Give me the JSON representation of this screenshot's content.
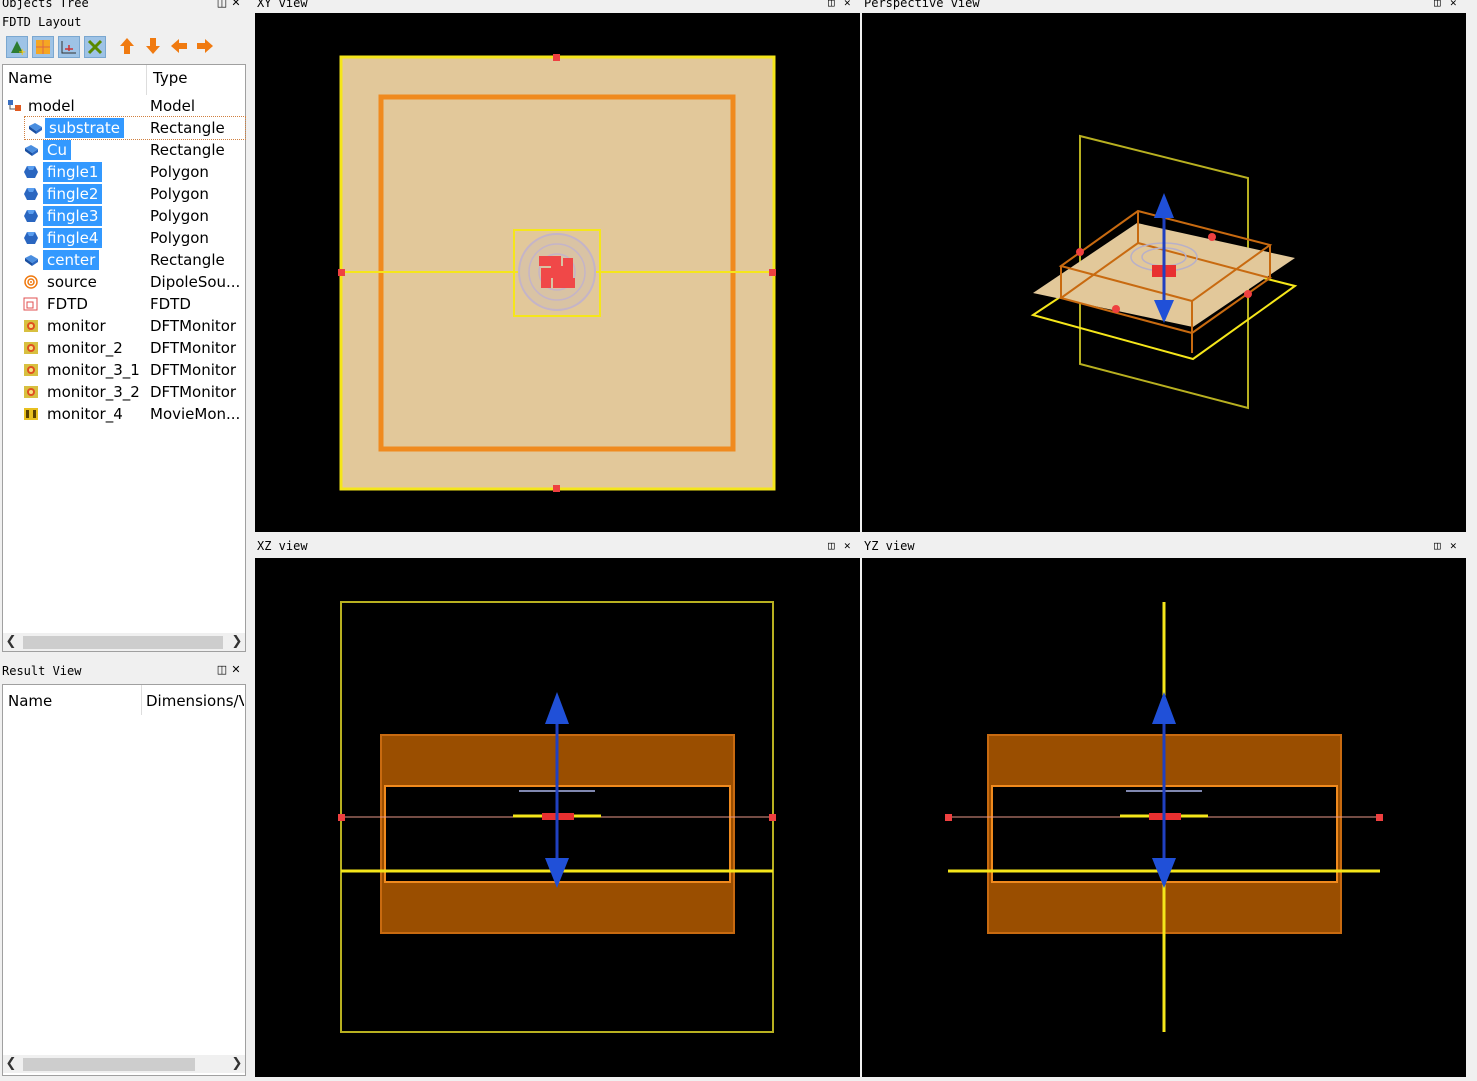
{
  "objects_tree": {
    "title": "Objects Tree",
    "subtitle": "FDTD Layout",
    "header": {
      "name": "Name",
      "type": "Type"
    },
    "rows": [
      {
        "name": "model",
        "type": "Model",
        "icon": "model-icon",
        "selected": false
      },
      {
        "name": "substrate",
        "type": "Rectangle",
        "icon": "rectangle-icon",
        "selected": true
      },
      {
        "name": "Cu",
        "type": "Rectangle",
        "icon": "rectangle-icon",
        "selected": true
      },
      {
        "name": "fingle1",
        "type": "Polygon",
        "icon": "polygon-icon",
        "selected": true
      },
      {
        "name": "fingle2",
        "type": "Polygon",
        "icon": "polygon-icon",
        "selected": true
      },
      {
        "name": "fingle3",
        "type": "Polygon",
        "icon": "polygon-icon",
        "selected": true
      },
      {
        "name": "fingle4",
        "type": "Polygon",
        "icon": "polygon-icon",
        "selected": true
      },
      {
        "name": "center",
        "type": "Rectangle",
        "icon": "rectangle-icon",
        "selected": true
      },
      {
        "name": "source",
        "type": "DipoleSou...",
        "icon": "source-icon",
        "selected": false
      },
      {
        "name": "FDTD",
        "type": "FDTD",
        "icon": "fdtd-icon",
        "selected": false
      },
      {
        "name": "monitor",
        "type": "DFTMonitor",
        "icon": "monitor-icon",
        "selected": false
      },
      {
        "name": "monitor_2",
        "type": "DFTMonitor",
        "icon": "monitor-icon",
        "selected": false
      },
      {
        "name": "monitor_3_1",
        "type": "DFTMonitor",
        "icon": "monitor-icon",
        "selected": false
      },
      {
        "name": "monitor_3_2",
        "type": "DFTMonitor",
        "icon": "monitor-icon",
        "selected": false
      },
      {
        "name": "monitor_4",
        "type": "MovieMon...",
        "icon": "movie-monitor-icon",
        "selected": false
      }
    ]
  },
  "result_view": {
    "title": "Result View",
    "header": {
      "name": "Name",
      "dims": "Dimensions/V"
    }
  },
  "views": {
    "xy": "XY view",
    "perspective": "Perspective view",
    "xz": "XZ view",
    "yz": "YZ view"
  },
  "colors": {
    "substrate": "#e2c89a",
    "cu_orange": "#f08a1e",
    "fdtd_yellow": "#f5e61a",
    "selection_blue": "#3399ff",
    "xz_fill": "#9a4e00"
  }
}
